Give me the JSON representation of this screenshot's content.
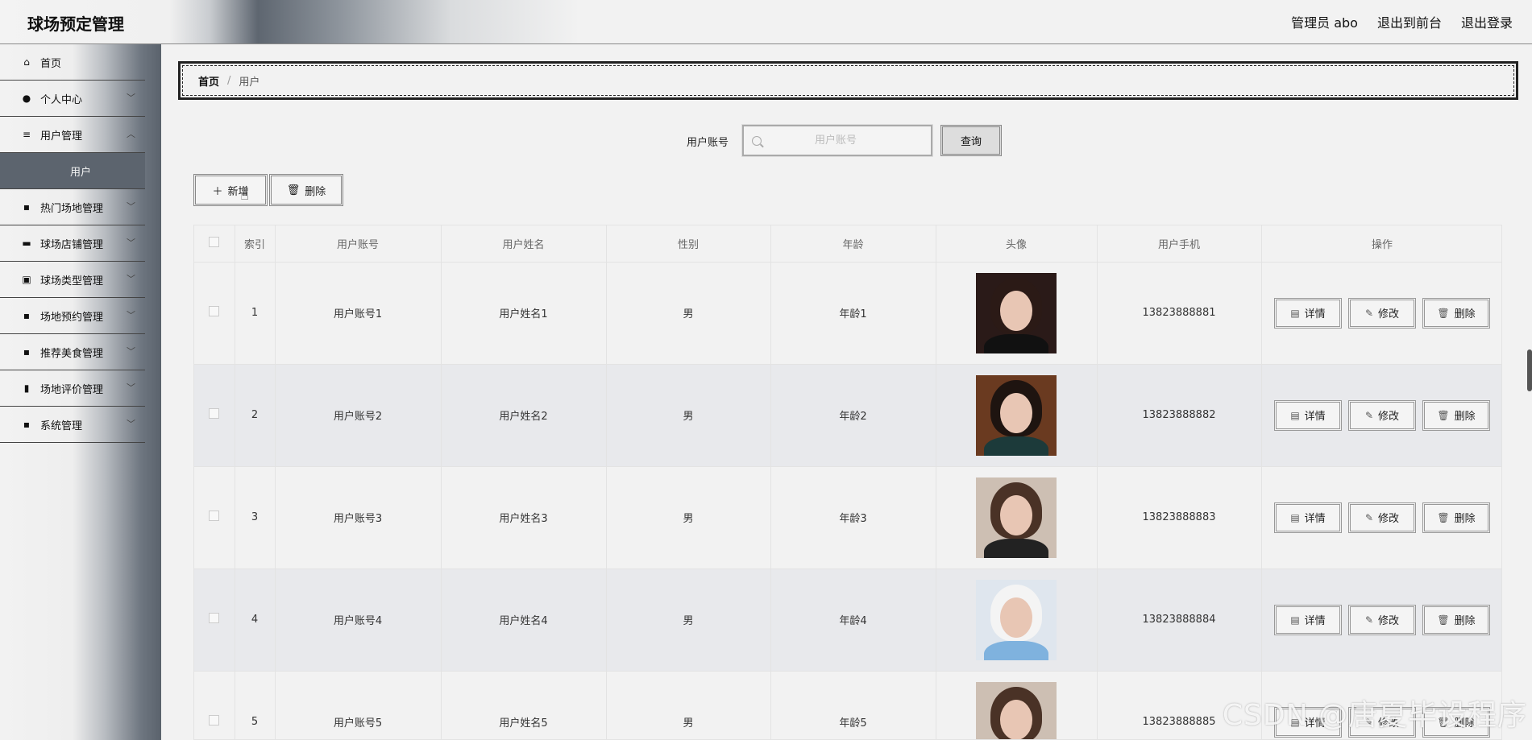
{
  "header": {
    "app_title": "球场预定管理",
    "admin": "管理员 abo",
    "to_front": "退出到前台",
    "logout": "退出登录"
  },
  "sidebar": {
    "items": [
      {
        "label": "首页",
        "icon": "home-icon",
        "chevron": false
      },
      {
        "label": "个人中心",
        "icon": "user-icon",
        "chevron": true
      },
      {
        "label": "用户管理",
        "icon": "list-icon",
        "chevron": true
      },
      {
        "label": "用户",
        "sub": true
      },
      {
        "label": "热门场地管理",
        "icon": "grid-icon",
        "chevron": true
      },
      {
        "label": "球场店铺管理",
        "icon": "shop-icon",
        "chevron": true
      },
      {
        "label": "球场类型管理",
        "icon": "briefcase-icon",
        "chevron": true
      },
      {
        "label": "场地预约管理",
        "icon": "grid-icon",
        "chevron": true
      },
      {
        "label": "推荐美食管理",
        "icon": "grid-icon",
        "chevron": true
      },
      {
        "label": "场地评价管理",
        "icon": "bar-chart-icon",
        "chevron": true
      },
      {
        "label": "系统管理",
        "icon": "grid-icon",
        "chevron": true
      }
    ]
  },
  "breadcrumb": {
    "home": "首页",
    "sep": "/",
    "current": "用户"
  },
  "search": {
    "label": "用户账号",
    "placeholder": "用户账号",
    "button": "查询"
  },
  "actions": {
    "add": "新增",
    "delete": "删除"
  },
  "table": {
    "headers": [
      "",
      "索引",
      "用户账号",
      "用户姓名",
      "性别",
      "年龄",
      "头像",
      "用户手机",
      "操作"
    ],
    "rows": [
      {
        "index": "1",
        "account": "用户账号1",
        "name": "用户姓名1",
        "gender": "男",
        "age": "年龄1",
        "phone": "13823888881"
      },
      {
        "index": "2",
        "account": "用户账号2",
        "name": "用户姓名2",
        "gender": "男",
        "age": "年龄2",
        "phone": "13823888882"
      },
      {
        "index": "3",
        "account": "用户账号3",
        "name": "用户姓名3",
        "gender": "男",
        "age": "年龄3",
        "phone": "13823888883"
      },
      {
        "index": "4",
        "account": "用户账号4",
        "name": "用户姓名4",
        "gender": "男",
        "age": "年龄4",
        "phone": "13823888884"
      },
      {
        "index": "5",
        "account": "用户账号5",
        "name": "用户姓名5",
        "gender": "男",
        "age": "年龄5",
        "phone": "13823888885"
      }
    ],
    "row_buttons": {
      "detail": "详情",
      "edit": "修改",
      "delete": "删除"
    }
  },
  "watermark": "CSDN @唐夏毕设程序",
  "colors": {
    "sidebar_active": "#5c646e",
    "row_alt": "#e8e9ec"
  }
}
